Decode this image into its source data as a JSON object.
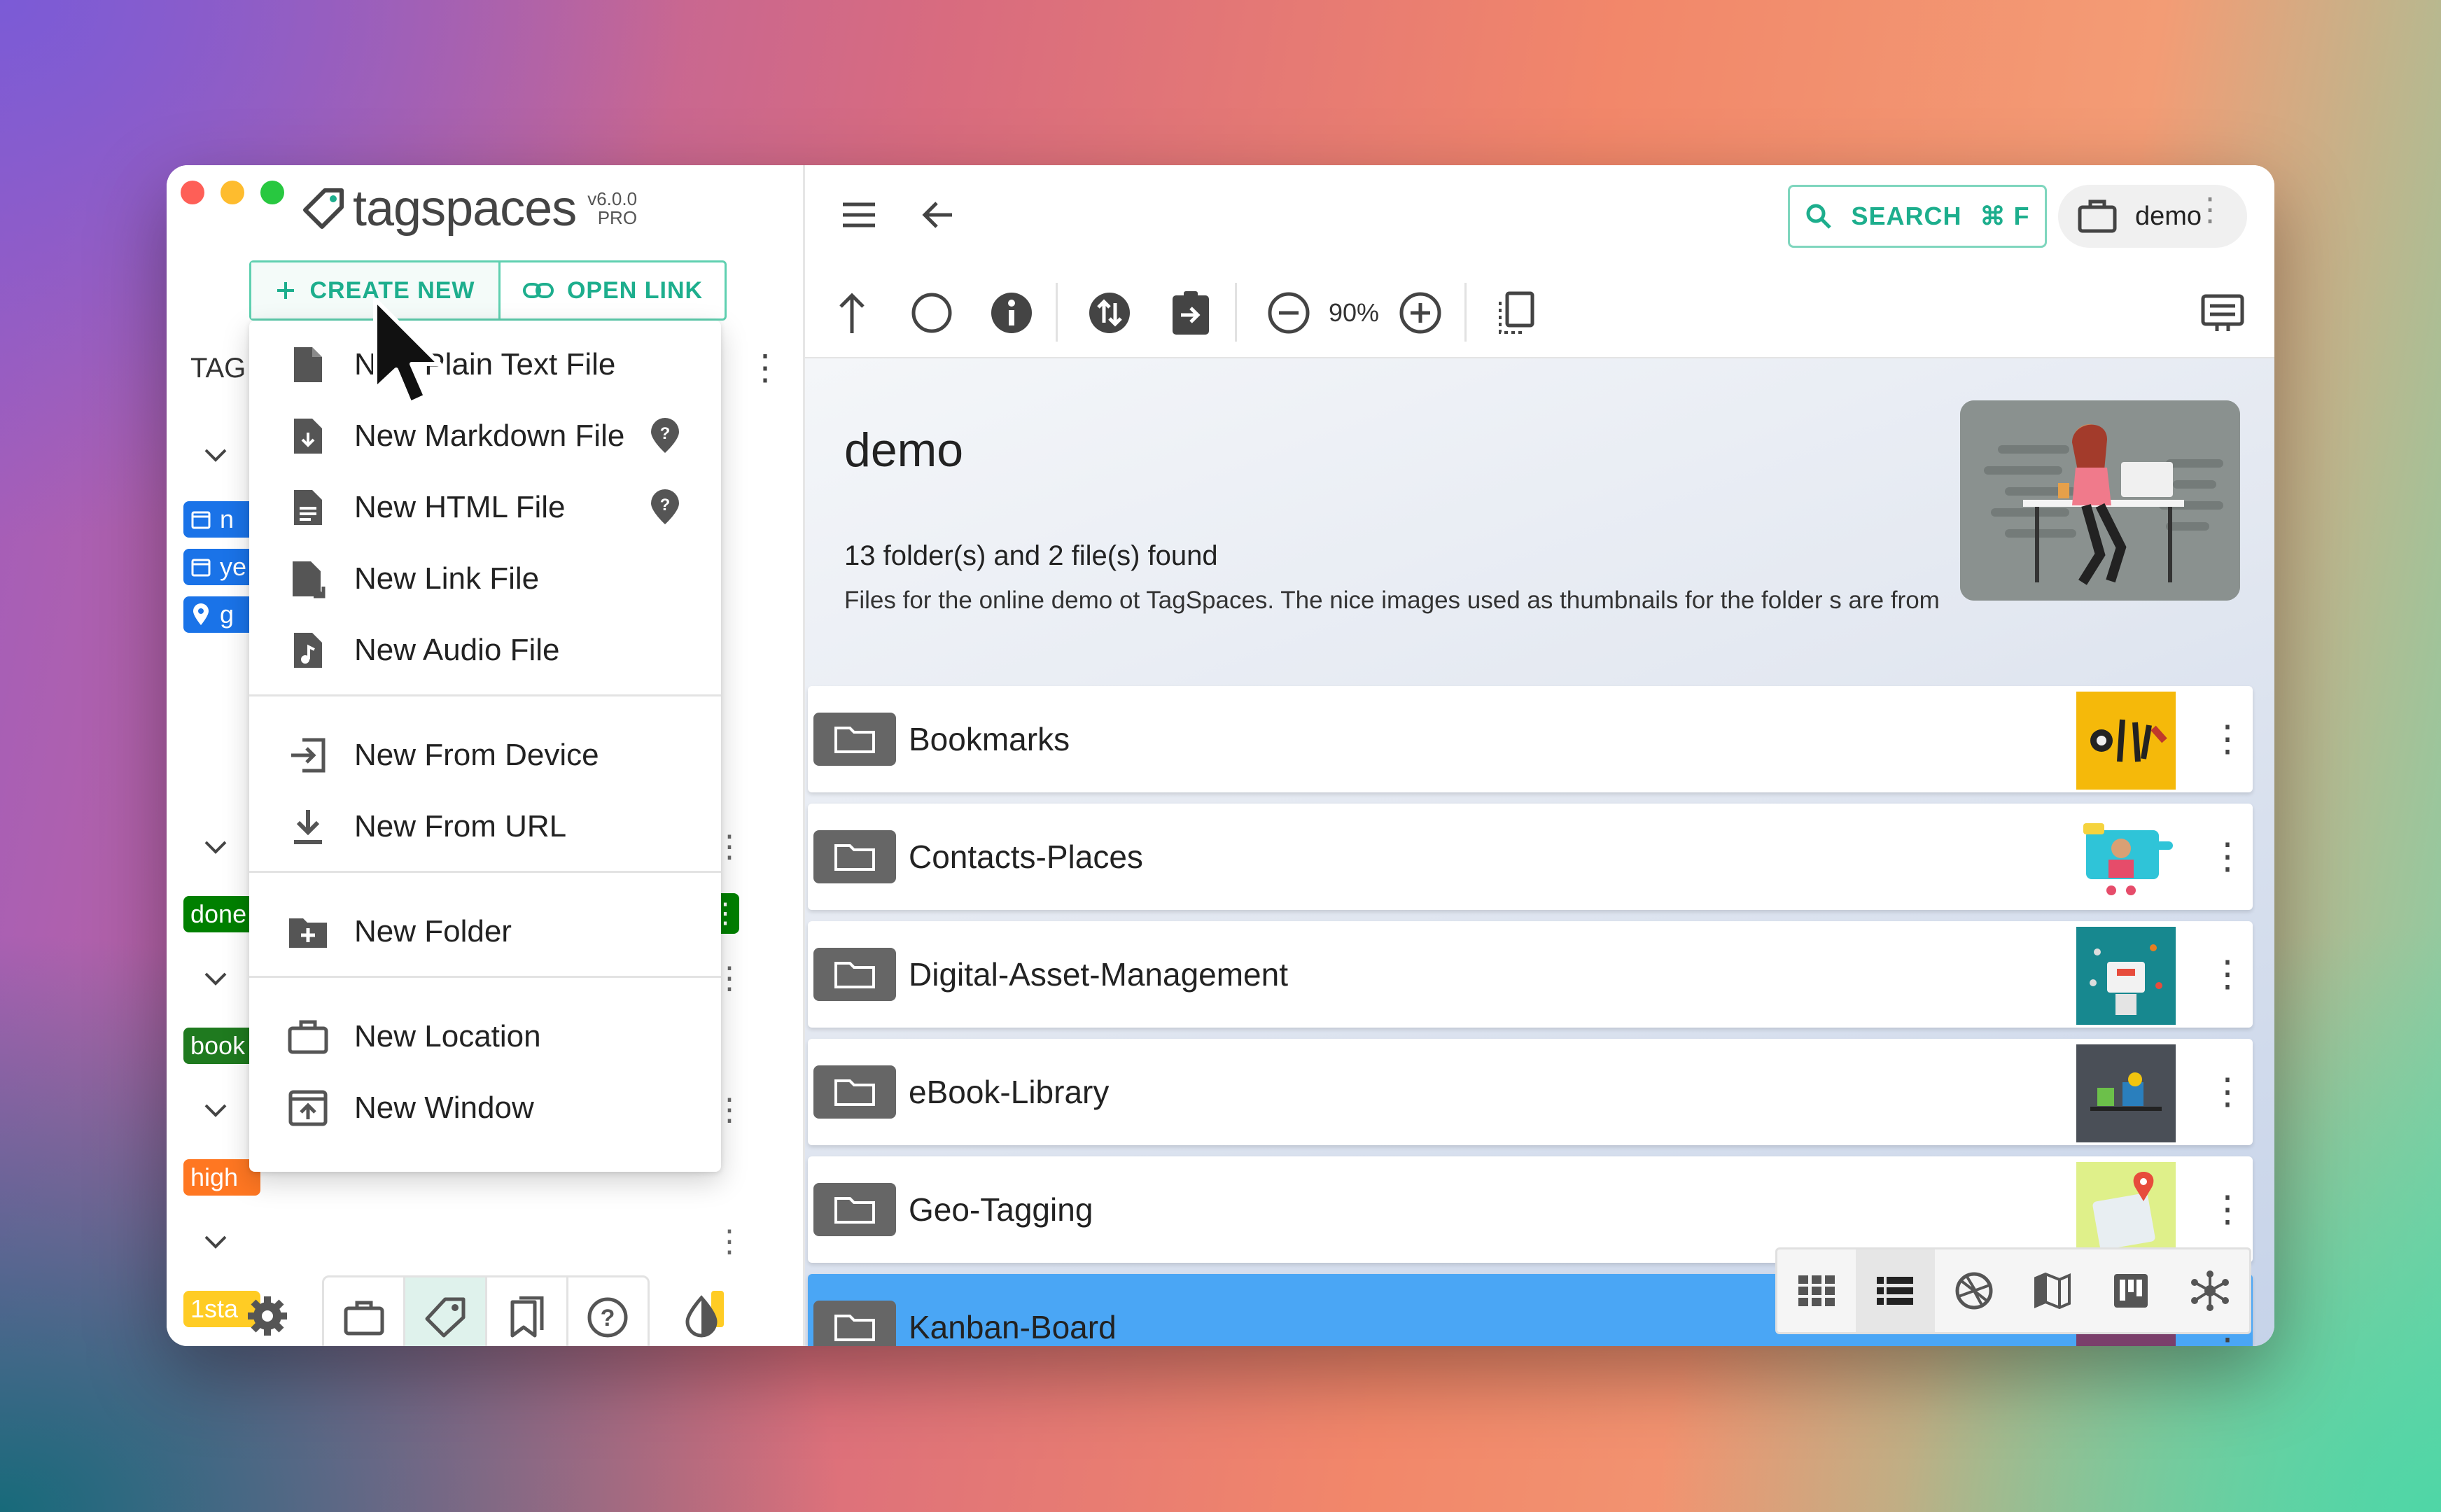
{
  "app": {
    "logo_text": "tagspaces",
    "version": "v6.0.0",
    "edition": "PRO"
  },
  "sidebar": {
    "create_new_label": "CREATE NEW",
    "open_link_label": "OPEN LINK",
    "tags_heading": "TAG",
    "tag_chips": [
      {
        "label": "n",
        "color": "#1a73e8",
        "icon": "calendar-icon"
      },
      {
        "label": "ye",
        "color": "#1a73e8",
        "icon": "calendar-icon"
      },
      {
        "label": "g",
        "color": "#1a73e8",
        "icon": "pin-icon"
      },
      {
        "label": "done",
        "color": "#008000"
      },
      {
        "label": "book",
        "color": "#1f7a1f"
      },
      {
        "label": "high",
        "color": "#ff7722"
      },
      {
        "label": "1sta",
        "color": "#ffcc24"
      }
    ]
  },
  "create_menu": {
    "items": [
      {
        "label": "New Plain Text File",
        "icon": "file-icon",
        "help": false
      },
      {
        "label": "New Markdown File",
        "icon": "markdown-file-icon",
        "help": true
      },
      {
        "label": "New HTML File",
        "icon": "html-file-icon",
        "help": true
      },
      {
        "label": "New Link File",
        "icon": "link-file-icon",
        "help": false
      },
      {
        "label": "New Audio File",
        "icon": "audio-file-icon",
        "help": false
      },
      {
        "label": "New From Device",
        "icon": "import-icon",
        "help": false
      },
      {
        "label": "New From URL",
        "icon": "download-icon",
        "help": false
      },
      {
        "label": "New Folder",
        "icon": "new-folder-icon",
        "help": false
      },
      {
        "label": "New Location",
        "icon": "briefcase-icon",
        "help": false
      },
      {
        "label": "New Window",
        "icon": "new-window-icon",
        "help": false
      }
    ]
  },
  "topbar": {
    "search_label": "SEARCH",
    "search_shortcut": "⌘ F",
    "location_name": "demo"
  },
  "toolbar": {
    "zoom": "90%"
  },
  "folder": {
    "title": "demo",
    "summary": "13 folder(s) and 2 file(s) found",
    "description": "Files for the online demo ot TagSpaces. The nice images used as thumbnails for the folder s are from"
  },
  "entries": [
    {
      "name": "Bookmarks",
      "thumb_color": "#f5b90a",
      "selected": false
    },
    {
      "name": "Contacts-Places",
      "thumb_color": "#ffffff",
      "selected": false
    },
    {
      "name": "Digital-Asset-Management",
      "thumb_color": "#17888f",
      "selected": false
    },
    {
      "name": "eBook-Library",
      "thumb_color": "#4a4f57",
      "selected": false
    },
    {
      "name": "Geo-Tagging",
      "thumb_color": "#dff08a",
      "selected": false
    },
    {
      "name": "Kanban-Board",
      "thumb_color": "#7a3f6b",
      "selected": true
    }
  ],
  "colors": {
    "accent": "#1dae8d",
    "selection": "#4aa6f5"
  }
}
